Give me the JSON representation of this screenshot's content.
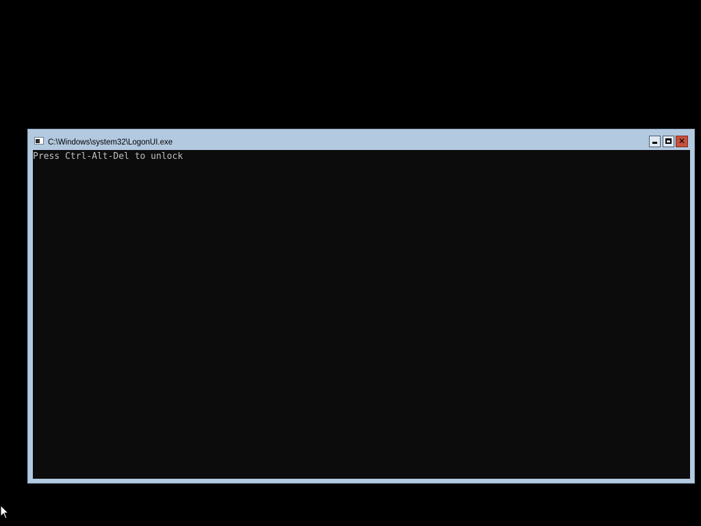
{
  "window": {
    "title": "C:\\Windows\\system32\\LogonUI.exe",
    "icon": "console-window-icon",
    "buttons": {
      "minimize_icon": "minimize-icon",
      "maximize_icon": "maximize-icon",
      "close_icon": "close-icon",
      "close_glyph": "✕"
    }
  },
  "console": {
    "lines": [
      "Press Ctrl-Alt-Del to unlock"
    ]
  },
  "colors": {
    "desktop_background": "#000000",
    "window_frame": "#b3c9e0",
    "console_background": "#0c0c0c",
    "console_text": "#c0c0c0",
    "close_button": "#c7503c"
  }
}
